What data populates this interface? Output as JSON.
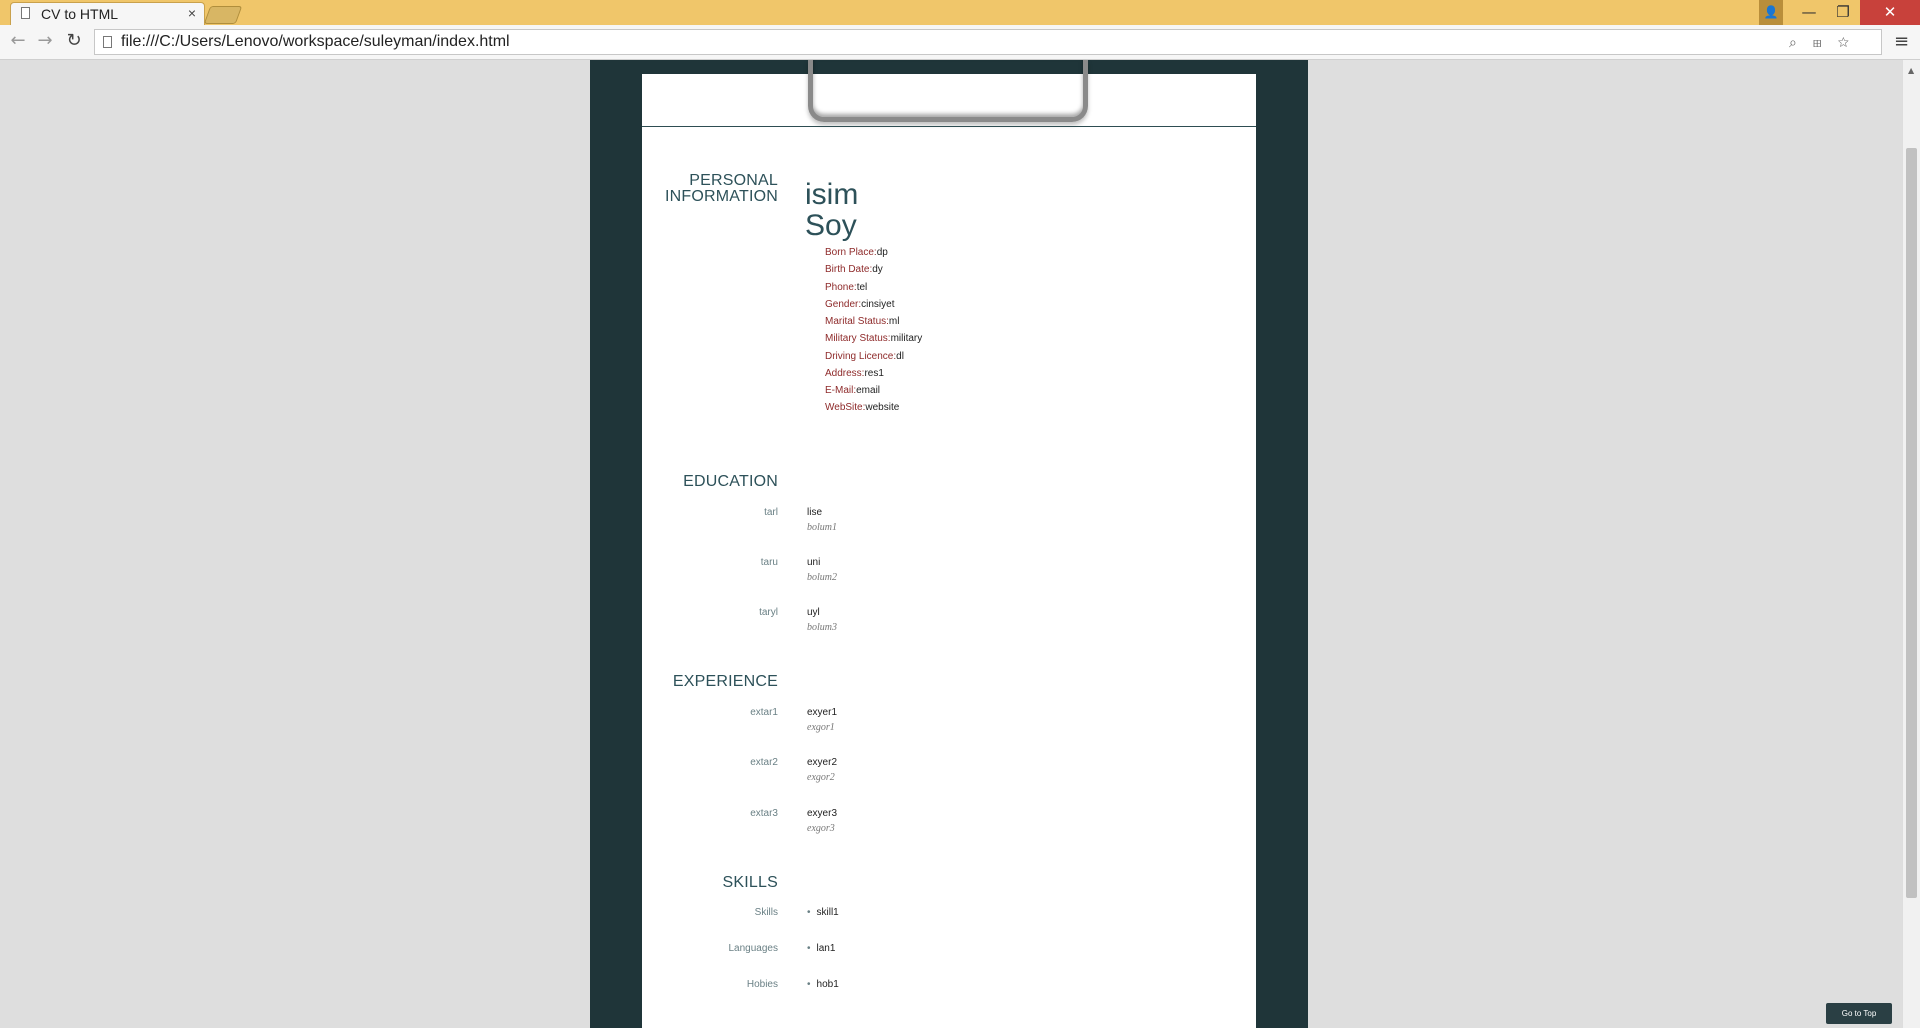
{
  "browser": {
    "tab_title": "CV to HTML",
    "tab_close": "×",
    "url": "file:///C:/Users/Lenovo/workspace/suleyman/index.html",
    "window_controls": {
      "minimize": "—",
      "maximize": "❐",
      "close": "✕",
      "profile": "👤"
    },
    "nav": {
      "back": "←",
      "forward": "→",
      "reload": "↻",
      "menu": "≡"
    },
    "omni_icons": "⌕ ⊞ ☆"
  },
  "cv": {
    "personal": {
      "section_title_1": "PERSONAL",
      "section_title_2": "INFORMATION",
      "first_name": "isim",
      "last_name": "Soy",
      "fields": [
        {
          "label": "Born Place:",
          "value": "dp"
        },
        {
          "label": "Birth Date:",
          "value": "dy"
        },
        {
          "label": "Phone:",
          "value": "tel"
        },
        {
          "label": "Gender:",
          "value": "cinsiyet"
        },
        {
          "label": "Marital Status:",
          "value": "ml"
        },
        {
          "label": "Military Status:",
          "value": "military"
        },
        {
          "label": "Driving Licence:",
          "value": "dl"
        },
        {
          "label": "Address:",
          "value": "res1"
        },
        {
          "label": "E-Mail:",
          "value": "email"
        },
        {
          "label": "WebSite:",
          "value": "website"
        }
      ]
    },
    "education": {
      "section_title": "EDUCATION",
      "entries": [
        {
          "date": "tarl",
          "title": "lise",
          "sub": "bolum1"
        },
        {
          "date": "taru",
          "title": "uni",
          "sub": "bolum2"
        },
        {
          "date": "taryl",
          "title": "uyl",
          "sub": "bolum3"
        }
      ]
    },
    "experience": {
      "section_title": "EXPERIENCE",
      "entries": [
        {
          "date": "extar1",
          "title": "exyer1",
          "sub": "exgor1"
        },
        {
          "date": "extar2",
          "title": "exyer2",
          "sub": "exgor2"
        },
        {
          "date": "extar3",
          "title": "exyer3",
          "sub": "exgor3"
        }
      ]
    },
    "skills": {
      "section_title": "SKILLS",
      "rows": [
        {
          "label": "Skills",
          "value": "skill1"
        },
        {
          "label": "Languages",
          "value": "lan1"
        },
        {
          "label": "Hobies",
          "value": "hob1"
        }
      ]
    }
  },
  "goto_top_label": "Go to Top"
}
